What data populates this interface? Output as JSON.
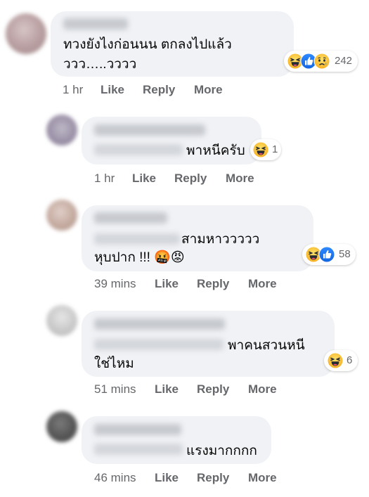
{
  "comments": [
    {
      "text_lines": [
        "ทวงยังไงก่อนนน ตกลงไปแล้ว",
        "ววว…..วววว"
      ],
      "time": "1 hr",
      "reaction_count": "242",
      "reaction_icons": [
        "haha-icon",
        "like-icon",
        "sad-icon"
      ]
    },
    {
      "text_lines": [
        "พาหนีครับ"
      ],
      "time": "1 hr",
      "reaction_count": "1",
      "reaction_icons": [
        "haha-icon"
      ]
    },
    {
      "text_lines": [
        "สามหาววววว",
        "หุบปาก !!! 🤬😡"
      ],
      "time": "39 mins",
      "reaction_count": "58",
      "reaction_icons": [
        "haha-icon",
        "like-icon"
      ]
    },
    {
      "text_lines": [
        "พาคนสวนหนี",
        "ใช่ไหม"
      ],
      "time": "51 mins",
      "reaction_count": "6",
      "reaction_icons": [
        "haha-icon"
      ]
    },
    {
      "text_lines": [
        "แรงมากกกก"
      ],
      "time": "46 mins",
      "reaction_count": "",
      "reaction_icons": []
    }
  ],
  "labels": {
    "like": "Like",
    "reply": "Reply",
    "more": "More"
  },
  "colors": {
    "bubble": "#f0f2f5",
    "meta": "#65676b",
    "like_blue": "#1877f2",
    "haha_yellow": "#f7b125",
    "angry_red": "#e9710f"
  }
}
